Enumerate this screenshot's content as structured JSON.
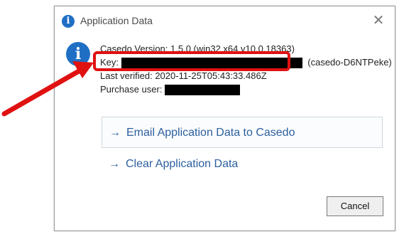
{
  "dialog": {
    "title": "Application Data",
    "close_glyph": "✕",
    "title_icon": "info-icon",
    "title_icon_glyph": "i"
  },
  "info": {
    "icon_glyph": "i",
    "version_line": "Casedo Version: 1.5.0 (win32 x64 v10.0.18363)",
    "key_label": "Key:",
    "key_suffix": "(casedo-D6NTPeke)",
    "last_verified_line": "Last verified: 2020-11-25T05:43:33.486Z",
    "purchase_label": "Purchase user:"
  },
  "actions": {
    "email_label": "Email Application Data to Casedo",
    "clear_label": "Clear Application Data",
    "arrow_glyph": "→"
  },
  "buttons": {
    "cancel_label": "Cancel"
  },
  "colors": {
    "highlight": "#e01111",
    "accent": "#1f6fc5",
    "link": "#2c5f9e"
  }
}
